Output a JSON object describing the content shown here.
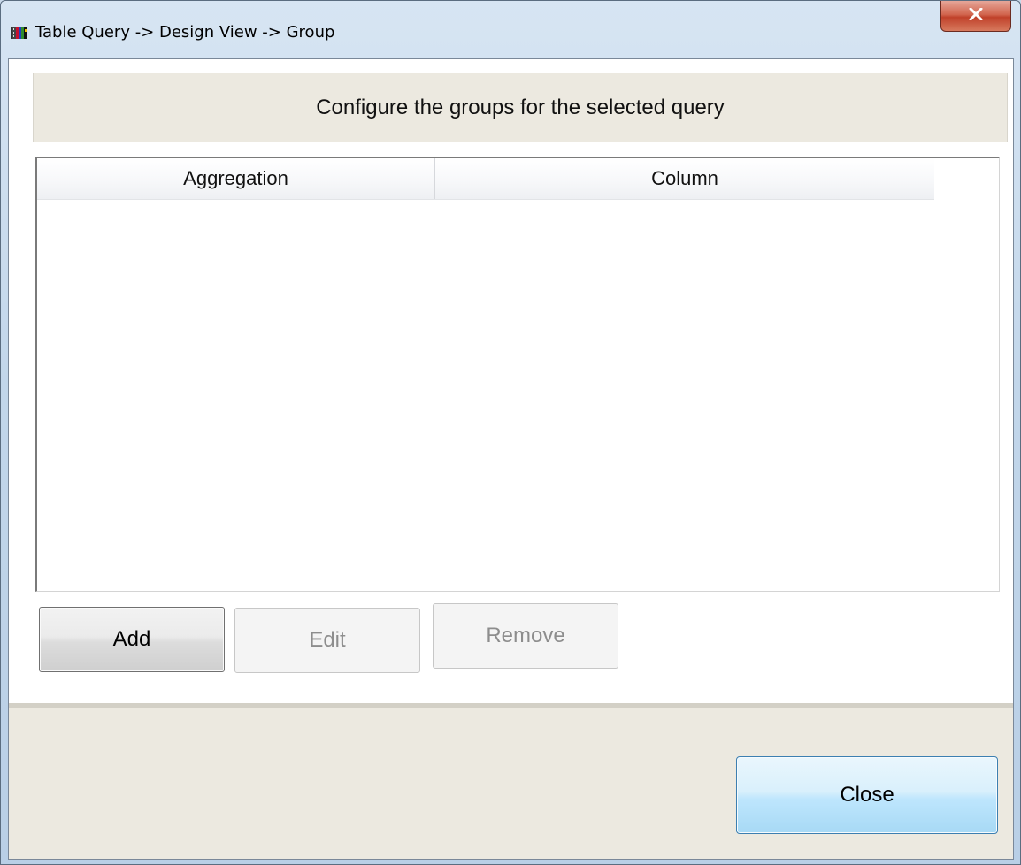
{
  "window": {
    "title": "Table Query -> Design View -> Group",
    "icon": "app-icon",
    "close_icon": "close-icon"
  },
  "header": {
    "text": "Configure the groups for the selected query"
  },
  "grid": {
    "columns": [
      "Aggregation",
      "Column"
    ],
    "rows": []
  },
  "buttons": {
    "add": "Add",
    "edit": "Edit",
    "remove": "Remove",
    "close": "Close"
  },
  "colors": {
    "header_panel_bg": "#ece9e0",
    "close_button_bg": "#bee6fd",
    "titlebar_close_red": "#c0412a"
  }
}
